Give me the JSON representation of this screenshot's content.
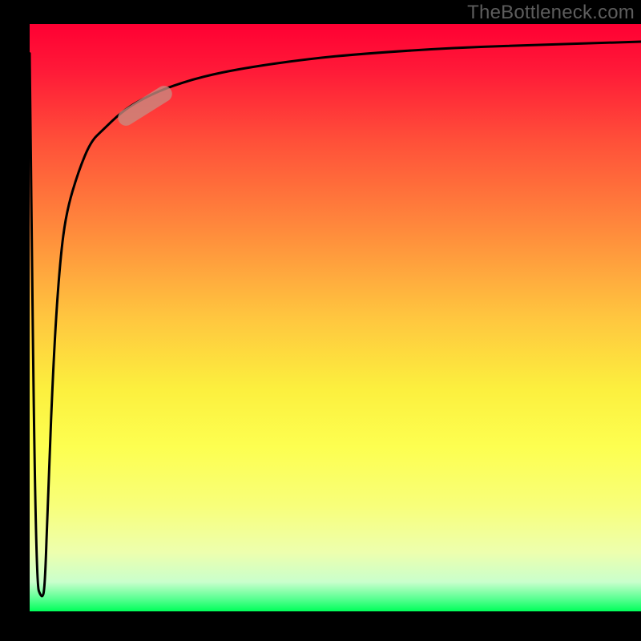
{
  "watermark": "TheBottleneck.com",
  "colors": {
    "background_frame": "#000000",
    "gradient_top": "#ff0033",
    "gradient_bottom": "#00ff5a",
    "curve": "#000000",
    "highlight": "rgba(200,140,130,0.78)",
    "watermark_text": "#5d5d5d"
  },
  "chart_data": {
    "type": "line",
    "title": "",
    "xlabel": "",
    "ylabel": "",
    "xlim": [
      0,
      100
    ],
    "ylim": [
      0,
      100
    ],
    "grid": false,
    "legend": false,
    "annotations": [
      {
        "label": "highlighted-segment",
        "x_range": [
          15,
          22
        ],
        "note": "elbow region emphasized with rounded stroke overlay"
      }
    ],
    "series": [
      {
        "name": "bottleneck-curve",
        "x": [
          0,
          1,
          2,
          2.5,
          3,
          4,
          5,
          6,
          8,
          10,
          12,
          15,
          18,
          22,
          28,
          35,
          45,
          55,
          70,
          85,
          100
        ],
        "values": [
          95,
          5,
          2,
          4,
          20,
          45,
          60,
          68,
          75,
          80,
          82,
          85,
          87,
          89,
          91,
          92.5,
          94,
          95,
          96,
          96.5,
          97
        ]
      }
    ],
    "background": "vertical rainbow gradient from red (top) through orange, yellow to green (bottom)"
  }
}
